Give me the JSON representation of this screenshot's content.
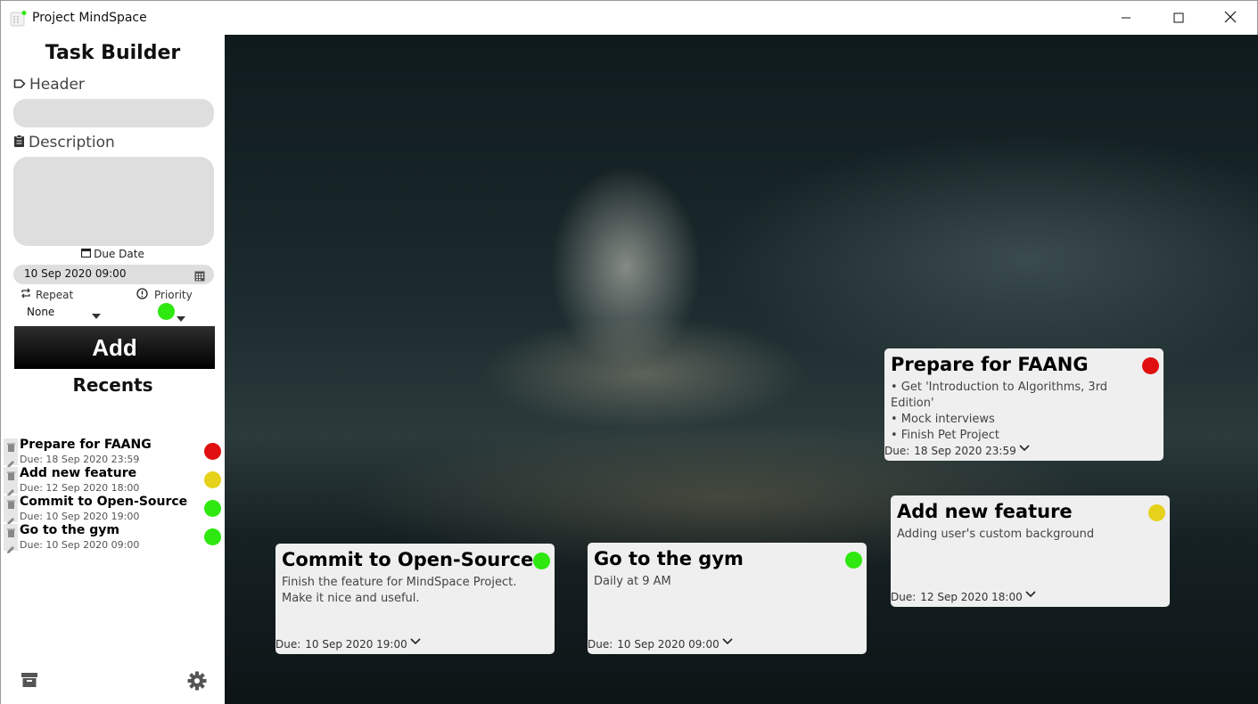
{
  "window": {
    "title": "Project MindSpace"
  },
  "sidebar": {
    "title": "Task Builder",
    "header_label": "Header",
    "description_label": "Description",
    "due_label": "Due Date",
    "due_value": "10 Sep 2020 09:00",
    "repeat_label": "Repeat",
    "repeat_value": "None",
    "priority_label": "Priority",
    "priority_color": "#2ee80f",
    "add_label": "Add",
    "recents_title": "Recents"
  },
  "recents": [
    {
      "title": "Prepare for FAANG",
      "due": "Due: 18 Sep 2020 23:59",
      "color": "#e01010"
    },
    {
      "title": "Add new feature",
      "due": "Due: 12 Sep 2020 18:00",
      "color": "#e6d21a"
    },
    {
      "title": "Commit to Open-Source",
      "due": "Due: 10 Sep 2020 19:00",
      "color": "#2ee80f"
    },
    {
      "title": "Go to the gym",
      "due": "Due: 10 Sep 2020 09:00",
      "color": "#2ee80f"
    }
  ],
  "cards": {
    "faang": {
      "title": "Prepare for FAANG",
      "lines": [
        "• Get 'Introduction to Algorithms, 3rd Edition'",
        "• Mock interviews",
        "• Finish Pet Project"
      ],
      "due_prefix": "Due:",
      "due": "18 Sep 2020 23:59",
      "color": "#e01010"
    },
    "feature": {
      "title": "Add new feature",
      "body": "Adding user's custom background",
      "due_prefix": "Due:",
      "due": "12 Sep 2020 18:00",
      "color": "#e6d21a"
    },
    "opensource": {
      "title": "Commit to Open-Source",
      "body": "Finish the feature for MindSpace Project. Make it nice and useful.",
      "due_prefix": "Due:",
      "due": "10 Sep 2020 19:00",
      "color": "#2ee80f"
    },
    "gym": {
      "title": "Go to the gym",
      "body": "Daily at 9 AM",
      "due_prefix": "Due:",
      "due": "10 Sep 2020 09:00",
      "color": "#2ee80f"
    }
  },
  "icons": {
    "app": "app-icon",
    "minimize": "minimize-icon",
    "maximize": "maximize-icon",
    "close": "close-icon",
    "header": "tag-icon",
    "description": "clipboard-icon",
    "due": "calendar-icon",
    "repeat": "repeat-icon",
    "priority": "alert-circle-icon",
    "archive": "archive-icon",
    "settings": "gear-icon",
    "delete": "trash-icon",
    "edit": "pencil-icon",
    "expand": "chevron-down-icon"
  }
}
